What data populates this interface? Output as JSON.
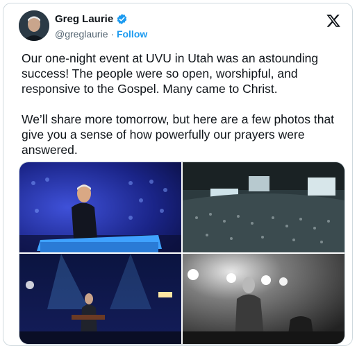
{
  "author": {
    "name": "Greg Laurie",
    "handle": "@greglaurie",
    "separator": "·",
    "follow_label": "Follow"
  },
  "icons": {
    "verified": "verified-badge-icon",
    "brand": "x-logo-icon"
  },
  "post": {
    "paragraph_1": "Our one-night event at UVU in Utah was an astounding success! The people were so open, worshipful, and responsive to the Gospel. Many came to Christ.",
    "paragraph_2": "We’ll share more tomorrow, but here are a few photos that give you a sense of how powerfully our prayers were answered."
  },
  "colors": {
    "accent": "#1d9bf0",
    "text": "#0f1419",
    "muted": "#536471",
    "border": "#cfd9de"
  },
  "media": {
    "count": 4
  }
}
